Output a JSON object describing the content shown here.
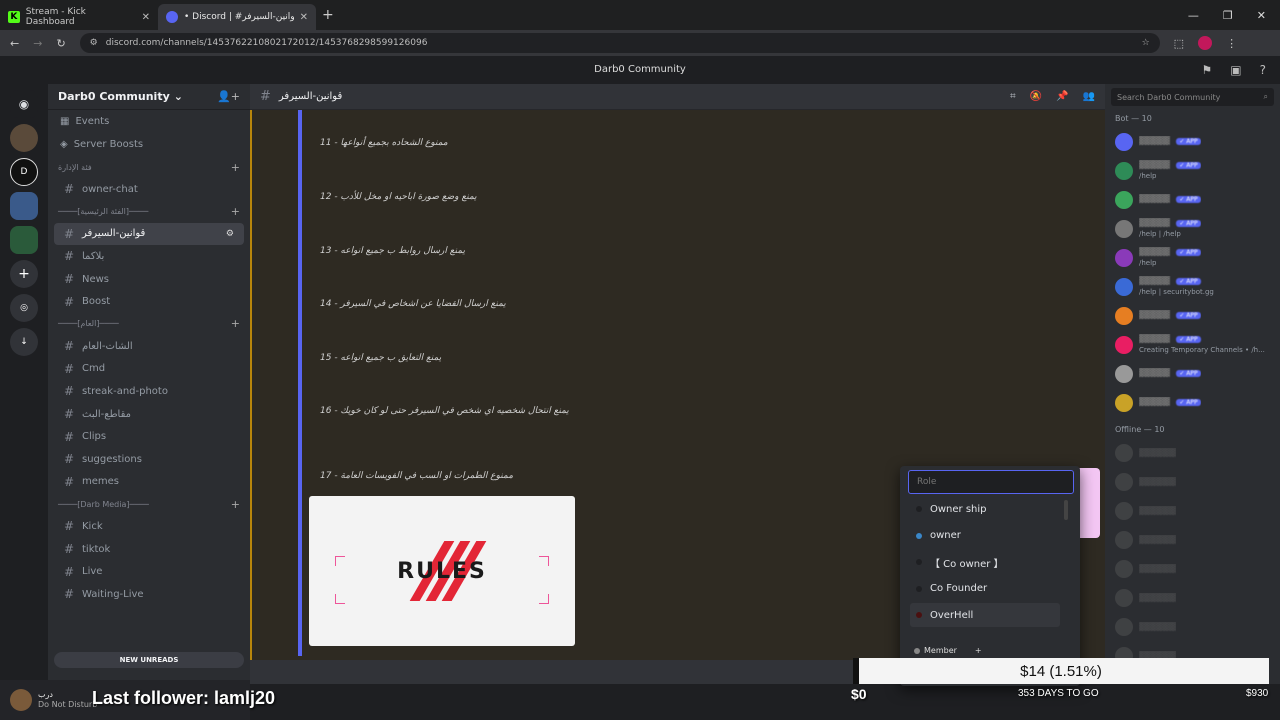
{
  "browser": {
    "tabs": [
      {
        "label": "Stream - Kick Dashboard",
        "active": false
      },
      {
        "label": "• Discord | #مو قوانين-السيرفر ،",
        "active": true
      }
    ],
    "url": "discord.com/channels/1453762210802172012/1453768298599126096"
  },
  "app_title": "Darb0 Community",
  "server": {
    "name": "Darb0 Community",
    "nav": [
      {
        "label": "Events",
        "icon": "calendar-icon"
      },
      {
        "label": "Server Boosts",
        "icon": "boost-icon"
      }
    ],
    "groups": [
      {
        "category": "فئة الإدارة",
        "channels": [
          {
            "label": "owner-chat",
            "selected": false
          }
        ]
      },
      {
        "category": "────[الفئة الرئيسية]────",
        "channels": [
          {
            "label": "قوانين-السيرفر",
            "selected": true
          },
          {
            "label": "بلاكما",
            "selected": false
          },
          {
            "label": "News",
            "selected": false
          },
          {
            "label": "Boost",
            "selected": false
          }
        ]
      },
      {
        "category": "────[العام]────",
        "channels": [
          {
            "label": "الشات-العام",
            "selected": false
          },
          {
            "label": "Cmd",
            "selected": false
          },
          {
            "label": "streak-and-photo",
            "selected": false
          },
          {
            "label": "مقاطع-البث",
            "selected": false
          },
          {
            "label": "Clips",
            "selected": false
          },
          {
            "label": "suggestions",
            "selected": false
          },
          {
            "label": "memes",
            "selected": false
          }
        ]
      },
      {
        "category": "────[Darb Media]────",
        "channels": [
          {
            "label": "Kick",
            "selected": false
          },
          {
            "label": "tiktok",
            "selected": false
          },
          {
            "label": "Live",
            "selected": false
          },
          {
            "label": "Waiting-Live",
            "selected": false
          }
        ]
      }
    ],
    "new_unreads": "NEW UNREADS"
  },
  "user": {
    "name": "درب",
    "status": "Do Not Disturb"
  },
  "channel": {
    "name": "قوانين-السيرفر"
  },
  "rules": [
    "11 - ممنوع الشحاده بجميع أنواعها",
    "12 - يمنع وضع صورة اباحيه او مخل للأدب",
    "13 - يمنع ارسال روابط ب جميع انواعه",
    "14 - يمنع ارسال القضايا عن اشخاص في السيرفر",
    "15 - يمنع التعايق ب جميع انواعه",
    "16 - يمنع انتحال شخصيه اي شخص في السيرفر حتى لو كان خويك",
    "17 - ممنوع الطمرات او السب في الفويسات العامة"
  ],
  "rules_image_text": "RULES",
  "members": {
    "search_placeholder": "Search Darb0 Community",
    "bot_heading": "Bot — 10",
    "bots": [
      {
        "sub": "",
        "color": "#5865f2"
      },
      {
        "sub": "/help",
        "color": "#2e8b57"
      },
      {
        "sub": "",
        "color": "#3ba55c"
      },
      {
        "sub": "/help | /help",
        "color": "#777"
      },
      {
        "sub": "/help",
        "color": "#8a3ab9"
      },
      {
        "sub": "/help | securitybot.gg",
        "color": "#3a6ad6"
      },
      {
        "sub": "",
        "color": "#e67e22"
      },
      {
        "sub": "Creating Temporary Channels • /h...",
        "color": "#e91e63"
      },
      {
        "sub": "",
        "color": "#999"
      },
      {
        "sub": "",
        "color": "#c9a227"
      }
    ],
    "app_badge": "✓ APP",
    "offline_heading": "Offline — 10",
    "offline_count": 10
  },
  "role_picker": {
    "placeholder": "Role",
    "roles": [
      {
        "label": "Owner ship",
        "color": "#1e1f22"
      },
      {
        "label": "owner",
        "color": "#3a87c9"
      },
      {
        "label": "【 Co owner 】",
        "color": "#1e1f22"
      },
      {
        "label": "Co Founder",
        "color": "#1e1f22"
      },
      {
        "label": "OverHell",
        "color": "#4a1010"
      }
    ],
    "member_label": "Member"
  },
  "overlay": {
    "last_follower": "Last follower: lamlj20",
    "goal_text": "$14 (1.51%)",
    "goal_fraction": 0.0151,
    "goal_min": "$0",
    "goal_max": "$930",
    "days_to_go": "353 DAYS TO GO"
  }
}
